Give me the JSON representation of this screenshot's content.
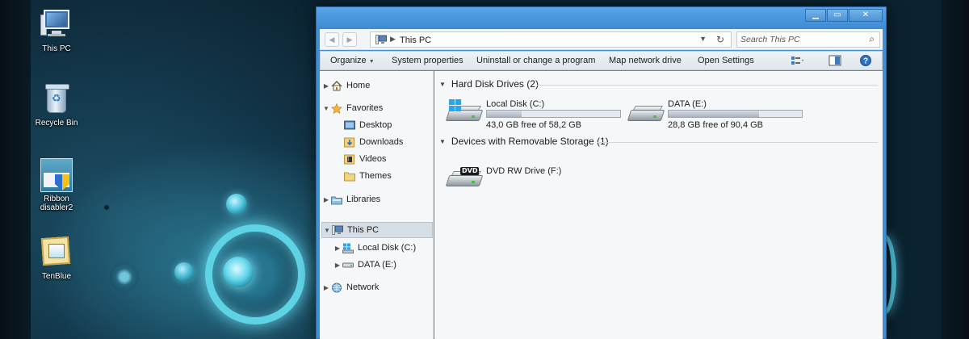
{
  "desktop": {
    "icons": [
      {
        "label": "This PC",
        "icon": "this-pc-icon"
      },
      {
        "label": "Recycle Bin",
        "icon": "recycle-bin-icon"
      },
      {
        "label": "Ribbon disabler2",
        "icon": "ribbon-disabler-icon"
      },
      {
        "label": "TenBlue",
        "icon": "tenblue-icon"
      }
    ]
  },
  "window": {
    "caption_buttons": {
      "minimize": "▁",
      "maximize": "▭",
      "close": "✕"
    },
    "address": {
      "path": "This PC"
    },
    "search": {
      "placeholder": "Search This PC"
    },
    "toolbar": {
      "organize": "Organize",
      "system_properties": "System properties",
      "uninstall": "Uninstall or change a program",
      "map_drive": "Map network drive",
      "open_settings": "Open Settings"
    },
    "nav": {
      "home": "Home",
      "favorites": "Favorites",
      "desktop": "Desktop",
      "downloads": "Downloads",
      "videos": "Videos",
      "themes": "Themes",
      "libraries": "Libraries",
      "this_pc": "This PC",
      "local_disk": "Local Disk (C:)",
      "data": "DATA (E:)",
      "network": "Network"
    },
    "content": {
      "hard_disk_group": "Hard Disk Drives (2)",
      "removable_group": "Devices with Removable Storage (1)",
      "drives": [
        {
          "name": "Local Disk (C:)",
          "free": "43,0 GB free of 58,2 GB",
          "used_fraction": 0.26
        },
        {
          "name": "DATA (E:)",
          "free": "28,8 GB free of 90,4 GB",
          "used_fraction": 0.68
        }
      ],
      "dvd": {
        "name": "DVD RW Drive (F:)",
        "badge": "DVD"
      }
    }
  },
  "colors": {
    "title_bar": "#3f8fd6",
    "window_bg": "#f5f7f9",
    "selection": "#d5dde5",
    "desktop_glow": "#5fd3e6"
  }
}
